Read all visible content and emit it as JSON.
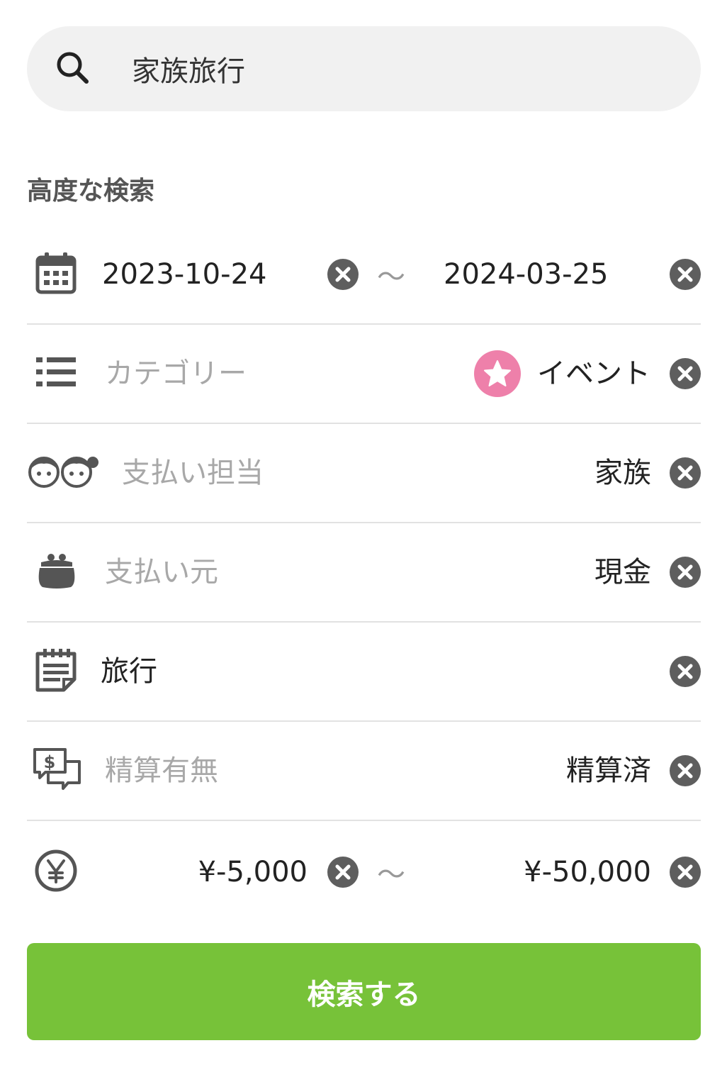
{
  "search": {
    "value": "家族旅行",
    "icon": "search-icon"
  },
  "advanced": {
    "title": "高度な検索"
  },
  "date": {
    "icon": "calendar-icon",
    "from": "2023-10-24",
    "separator": "〜",
    "to": "2024-03-25"
  },
  "category": {
    "icon": "list-icon",
    "placeholder": "カテゴリー",
    "badge_icon": "star-icon",
    "badge_color": "#ee80aa",
    "value": "イベント"
  },
  "payer": {
    "icon": "people-icon",
    "placeholder": "支払い担当",
    "value": "家族"
  },
  "source": {
    "icon": "purse-icon",
    "placeholder": "支払い元",
    "value": "現金"
  },
  "memo": {
    "icon": "notepad-icon",
    "value": "旅行"
  },
  "settlement": {
    "icon": "chat-dollar-icon",
    "placeholder": "精算有無",
    "value": "精算済"
  },
  "amount": {
    "icon": "yen-icon",
    "from": "¥-5,000",
    "separator": "〜",
    "to": "¥-50,000"
  },
  "submit": {
    "label": "検索する",
    "color": "#77c239"
  },
  "colors": {
    "clear_button": "#5e5e5e",
    "icon": "#555555",
    "divider": "#e2e2e2"
  }
}
